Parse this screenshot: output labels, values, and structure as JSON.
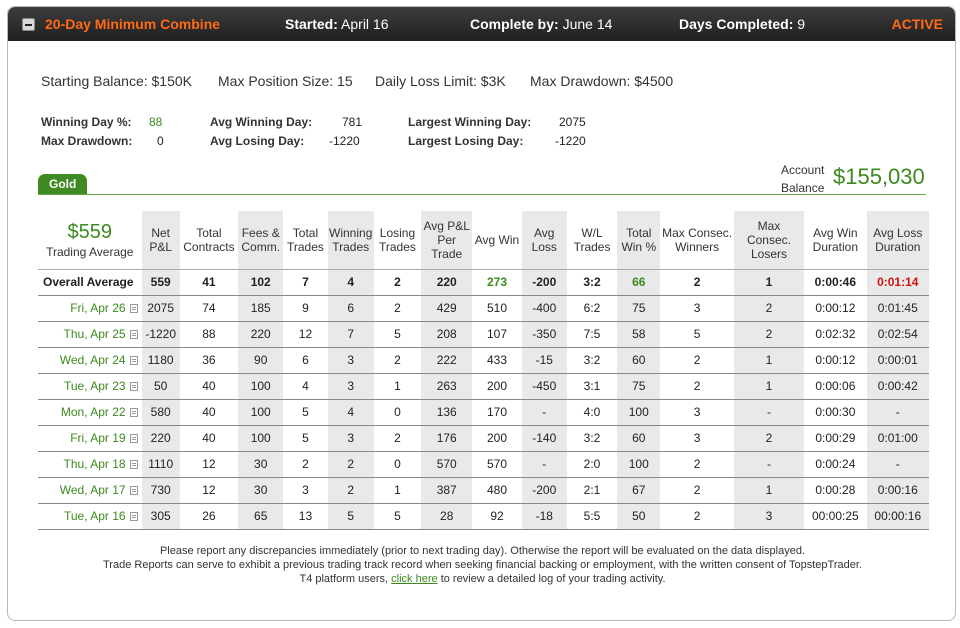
{
  "header": {
    "title": "20-Day Minimum Combine",
    "started_label": "Started:",
    "started_value": "April 16",
    "complete_label": "Complete by:",
    "complete_value": "June 14",
    "days_label": "Days Completed:",
    "days_value": "9",
    "status": "ACTIVE"
  },
  "rules": {
    "starting_balance": "Starting Balance: $150K",
    "max_position": "Max Position Size: 15",
    "daily_loss": "Daily Loss Limit: $3K",
    "max_drawdown": "Max Drawdown: $4500"
  },
  "stats": {
    "winning_day_label": "Winning Day %:",
    "winning_day_value": "88",
    "max_drawdown_label": "Max Drawdown:",
    "max_drawdown_value": "0",
    "avg_winning_label": "Avg Winning Day:",
    "avg_winning_value": "781",
    "avg_losing_label": "Avg Losing Day:",
    "avg_losing_value": "-1220",
    "largest_winning_label": "Largest Winning Day:",
    "largest_winning_value": "2075",
    "largest_losing_label": "Largest Losing Day:",
    "largest_losing_value": "-1220"
  },
  "account": {
    "label_line1": "Account",
    "label_line2": "Balance",
    "value": "$155,030"
  },
  "tab": {
    "label": "Gold"
  },
  "summary": {
    "trading_average": "$559",
    "trading_average_label": "Trading Average"
  },
  "table": {
    "headers": [
      "Net P&L",
      "Total Contracts",
      "Fees & Comm.",
      "Total Trades",
      "Winning Trades",
      "Losing Trades",
      "Avg P&L Per Trade",
      "Avg Win",
      "Avg Loss",
      "W/L Trades",
      "Total Win %",
      "Max Consec. Winners",
      "Max Consec. Losers",
      "Avg Win Duration",
      "Avg Loss Duration"
    ],
    "overall": [
      "Overall Average",
      "559",
      "41",
      "102",
      "7",
      "4",
      "2",
      "220",
      "273",
      "-200",
      "3:2",
      "66",
      "2",
      "1",
      "0:00:46",
      "0:01:14"
    ],
    "rows": [
      [
        "Fri, Apr 26",
        "2075",
        "74",
        "185",
        "9",
        "6",
        "2",
        "429",
        "510",
        "-400",
        "6:2",
        "75",
        "3",
        "2",
        "0:00:12",
        "0:01:45"
      ],
      [
        "Thu, Apr 25",
        "-1220",
        "88",
        "220",
        "12",
        "7",
        "5",
        "208",
        "107",
        "-350",
        "7:5",
        "58",
        "5",
        "2",
        "0:02:32",
        "0:02:54"
      ],
      [
        "Wed, Apr 24",
        "1180",
        "36",
        "90",
        "6",
        "3",
        "2",
        "222",
        "433",
        "-15",
        "3:2",
        "60",
        "2",
        "1",
        "0:00:12",
        "0:00:01"
      ],
      [
        "Tue, Apr 23",
        "50",
        "40",
        "100",
        "4",
        "3",
        "1",
        "263",
        "200",
        "-450",
        "3:1",
        "75",
        "2",
        "1",
        "0:00:06",
        "0:00:42"
      ],
      [
        "Mon, Apr 22",
        "580",
        "40",
        "100",
        "5",
        "4",
        "0",
        "136",
        "170",
        "-",
        "4:0",
        "100",
        "3",
        "-",
        "0:00:30",
        "-"
      ],
      [
        "Fri, Apr 19",
        "220",
        "40",
        "100",
        "5",
        "3",
        "2",
        "176",
        "200",
        "-140",
        "3:2",
        "60",
        "3",
        "2",
        "0:00:29",
        "0:01:00"
      ],
      [
        "Thu, Apr 18",
        "1110",
        "12",
        "30",
        "2",
        "2",
        "0",
        "570",
        "570",
        "-",
        "2:0",
        "100",
        "2",
        "-",
        "0:00:24",
        "-"
      ],
      [
        "Wed, Apr 17",
        "730",
        "12",
        "30",
        "3",
        "2",
        "1",
        "387",
        "480",
        "-200",
        "2:1",
        "67",
        "2",
        "1",
        "0:00:28",
        "0:00:16"
      ],
      [
        "Tue, Apr 16",
        "305",
        "26",
        "65",
        "13",
        "5",
        "5",
        "28",
        "92",
        "-18",
        "5:5",
        "50",
        "2",
        "3",
        "00:00:25",
        "00:00:16"
      ]
    ]
  },
  "footer": {
    "line1": "Please report any discrepancies immediately (prior to next trading day). Otherwise the report will be evaluated on the data displayed.",
    "line2": "Trade Reports can serve to exhibit a previous trading track record when seeking financial backing or employment, with the written consent of TopstepTrader.",
    "line3_pre": "T4 platform users,",
    "link": "click here",
    "line3_post": "to review a detailed log of your trading activity."
  }
}
